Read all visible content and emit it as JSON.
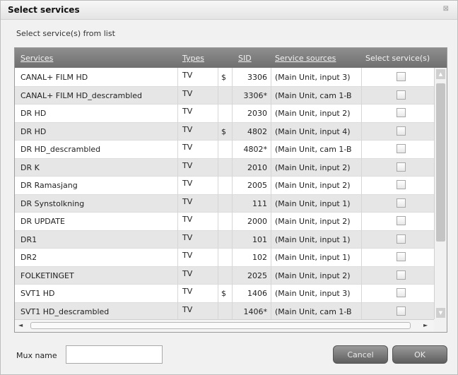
{
  "dialog": {
    "title": "Select services",
    "close_glyph": "⊠",
    "subtitle": "Select service(s) from list"
  },
  "grid": {
    "columns": {
      "services": "Services",
      "types": "Types",
      "sid": "SID",
      "sources": "Service sources",
      "select": "Select service(s)"
    },
    "rows": [
      {
        "service": "CANAL+ FILM HD",
        "type": "TV",
        "currency": "$",
        "sid": "3306",
        "source": "(Main Unit, input 3)",
        "selected": false
      },
      {
        "service": "CANAL+ FILM HD_descrambled",
        "type": "TV",
        "currency": "",
        "sid": "3306*",
        "source": "(Main Unit, cam 1-B",
        "selected": false
      },
      {
        "service": "DR HD",
        "type": "TV",
        "currency": "",
        "sid": "2030",
        "source": "(Main Unit, input 2)",
        "selected": false
      },
      {
        "service": "DR HD",
        "type": "TV",
        "currency": "$",
        "sid": "4802",
        "source": "(Main Unit, input 4)",
        "selected": false
      },
      {
        "service": "DR HD_descrambled",
        "type": "TV",
        "currency": "",
        "sid": "4802*",
        "source": "(Main Unit, cam 1-B",
        "selected": false
      },
      {
        "service": "DR K",
        "type": "TV",
        "currency": "",
        "sid": "2010",
        "source": "(Main Unit, input 2)",
        "selected": false
      },
      {
        "service": "DR Ramasjang",
        "type": "TV",
        "currency": "",
        "sid": "2005",
        "source": "(Main Unit, input 2)",
        "selected": false
      },
      {
        "service": "DR Synstolkning",
        "type": "TV",
        "currency": "",
        "sid": "111",
        "source": "(Main Unit, input 1)",
        "selected": false
      },
      {
        "service": "DR UPDATE",
        "type": "TV",
        "currency": "",
        "sid": "2000",
        "source": "(Main Unit, input 2)",
        "selected": false
      },
      {
        "service": "DR1",
        "type": "TV",
        "currency": "",
        "sid": "101",
        "source": "(Main Unit, input 1)",
        "selected": false
      },
      {
        "service": "DR2",
        "type": "TV",
        "currency": "",
        "sid": "102",
        "source": "(Main Unit, input 1)",
        "selected": false
      },
      {
        "service": "FOLKETINGET",
        "type": "TV",
        "currency": "",
        "sid": "2025",
        "source": "(Main Unit, input 2)",
        "selected": false
      },
      {
        "service": "SVT1 HD",
        "type": "TV",
        "currency": "$",
        "sid": "1406",
        "source": "(Main Unit, input 3)",
        "selected": false
      },
      {
        "service": "SVT1 HD_descrambled",
        "type": "TV",
        "currency": "",
        "sid": "1406*",
        "source": "(Main Unit, cam 1-B",
        "selected": false
      }
    ],
    "scroll_up_glyph": "▲",
    "scroll_down_glyph": "▼",
    "scroll_left_glyph": "◄",
    "scroll_right_glyph": "►"
  },
  "footer": {
    "mux_label": "Mux name",
    "mux_value": "",
    "cancel_label": "Cancel",
    "ok_label": "OK"
  }
}
